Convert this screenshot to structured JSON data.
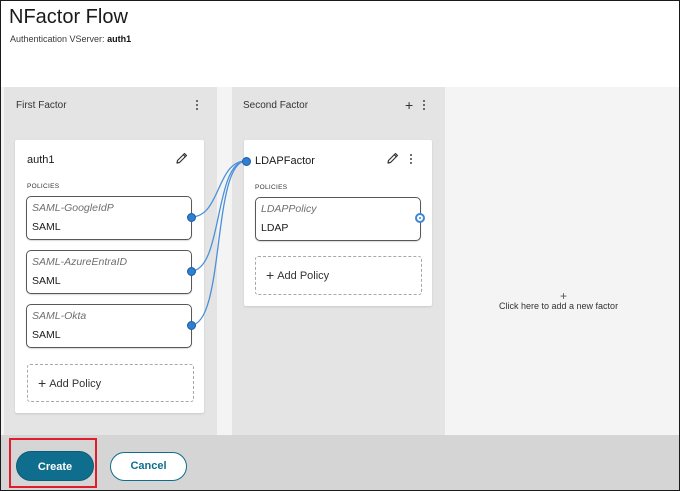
{
  "header": {
    "title": "NFactor Flow",
    "subtitle_label": "Authentication VServer:",
    "subtitle_value": "auth1"
  },
  "columns": [
    {
      "header": "First Factor",
      "factor": {
        "name": "auth1",
        "policies_label": "POLICIES",
        "policies": [
          {
            "name": "SAML-GoogleIdP",
            "type": "SAML"
          },
          {
            "name": "SAML-AzureEntraID",
            "type": "SAML"
          },
          {
            "name": "SAML-Okta",
            "type": "SAML"
          }
        ],
        "add_policy_label": "Add Policy"
      }
    },
    {
      "header": "Second Factor",
      "factor": {
        "name": "LDAPFactor",
        "policies_label": "POLICIES",
        "policies": [
          {
            "name": "LDAPPolicy",
            "type": "LDAP"
          }
        ],
        "add_policy_label": "Add Policy"
      }
    }
  ],
  "new_factor": {
    "label": "Click here to add a new factor"
  },
  "footer": {
    "create_label": "Create",
    "cancel_label": "Cancel"
  },
  "colors": {
    "primary": "#0f6e8d",
    "connector": "#4a90d9",
    "highlight": "#e21d2b"
  },
  "icons": {
    "edit": "pencil-icon",
    "more": "kebab-menu-icon",
    "add": "plus-icon"
  }
}
